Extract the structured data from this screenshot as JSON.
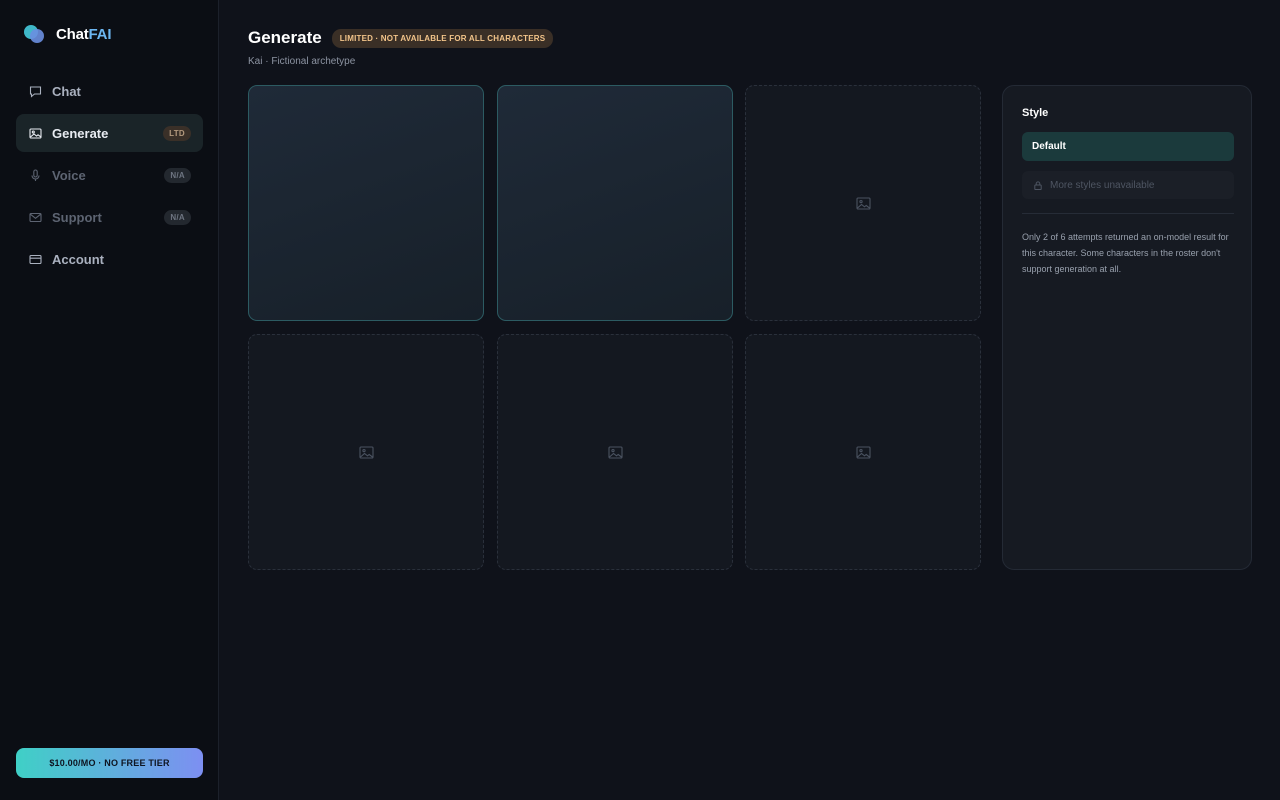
{
  "brand": {
    "name_main": "Chat",
    "name_accent": "FAI",
    "logo_icon": "chat-bubbles-icon"
  },
  "nav": {
    "items": [
      {
        "label": "Chat",
        "icon": "chat-icon",
        "badge": "",
        "state": "normal"
      },
      {
        "label": "Generate",
        "icon": "image-icon",
        "badge": "LTD",
        "state": "active"
      },
      {
        "label": "Voice",
        "icon": "mic-icon",
        "badge": "N/A",
        "state": "disabled"
      },
      {
        "label": "Support",
        "icon": "mail-icon",
        "badge": "N/A",
        "state": "disabled"
      },
      {
        "label": "Account",
        "icon": "card-icon",
        "badge": "",
        "state": "normal"
      }
    ]
  },
  "pricing": {
    "label": "$10.00/MO · NO FREE TIER"
  },
  "header": {
    "title": "Generate",
    "badge": "LIMITED · NOT AVAILABLE FOR ALL CHARACTERS",
    "subtitle": "Kai · Fictional archetype"
  },
  "grid": {
    "tiles": [
      {
        "state": "result"
      },
      {
        "state": "result"
      },
      {
        "state": "empty",
        "icon": "image-placeholder-icon"
      },
      {
        "state": "empty",
        "icon": "image-placeholder-icon"
      },
      {
        "state": "empty",
        "icon": "image-placeholder-icon"
      },
      {
        "state": "empty",
        "icon": "image-placeholder-icon"
      }
    ]
  },
  "panel": {
    "title": "Style",
    "selected_style": "Default",
    "locked_text": "More styles unavailable",
    "locked_icon": "lock-icon",
    "note": "Only 2 of 6 attempts returned an on-model result for this character. Some characters in the roster don't support generation at all."
  },
  "colors": {
    "background": "#0f121a",
    "sidebar": "#0b0e14",
    "accent_teal": "#3fd0c6",
    "accent_violet": "#7d8ff2",
    "badge_text": "#f2c48a"
  }
}
